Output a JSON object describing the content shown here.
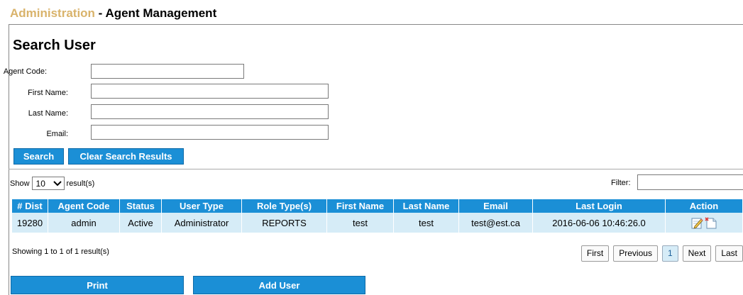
{
  "page": {
    "section": "Administration",
    "separator": " - ",
    "title": "Agent Management"
  },
  "search": {
    "heading": "Search User",
    "fields": [
      {
        "label": "Agent Code:",
        "value": "",
        "placeholder": ""
      },
      {
        "label": "First Name:",
        "value": "",
        "placeholder": ""
      },
      {
        "label": "Last Name:",
        "value": "",
        "placeholder": ""
      },
      {
        "label": "Email:",
        "value": "",
        "placeholder": ""
      }
    ],
    "search_button": "Search",
    "clear_button": "Clear Search Results"
  },
  "list_controls": {
    "show_label": "Show",
    "page_size": "10",
    "result_suffix": "result(s)",
    "filter_label": "Filter:",
    "filter_value": ""
  },
  "table": {
    "columns": [
      "# Dist",
      "Agent Code",
      "Status",
      "User Type",
      "Role Type(s)",
      "First Name",
      "Last Name",
      "Email",
      "Last Login",
      "Action"
    ],
    "rows": [
      {
        "dist": "19280",
        "agent_code": "admin",
        "status": "Active",
        "user_type": "Administrator",
        "role_types": "REPORTS",
        "first_name": "test",
        "last_name": "test",
        "email": "test@est.ca",
        "last_login": "2016-06-06 10:46:26.0",
        "actions": [
          "edit-icon",
          "delete-icon"
        ]
      }
    ]
  },
  "pagination": {
    "summary": "Showing 1 to 1 of 1 result(s)",
    "first": "First",
    "previous": "Previous",
    "current": "1",
    "next": "Next",
    "last": "Last"
  },
  "actions": {
    "print": "Print",
    "add_user": "Add User"
  },
  "colors": {
    "accent": "#1b8fd6",
    "section_title": "#d9b36b",
    "row_background": "#d6ecf7"
  }
}
